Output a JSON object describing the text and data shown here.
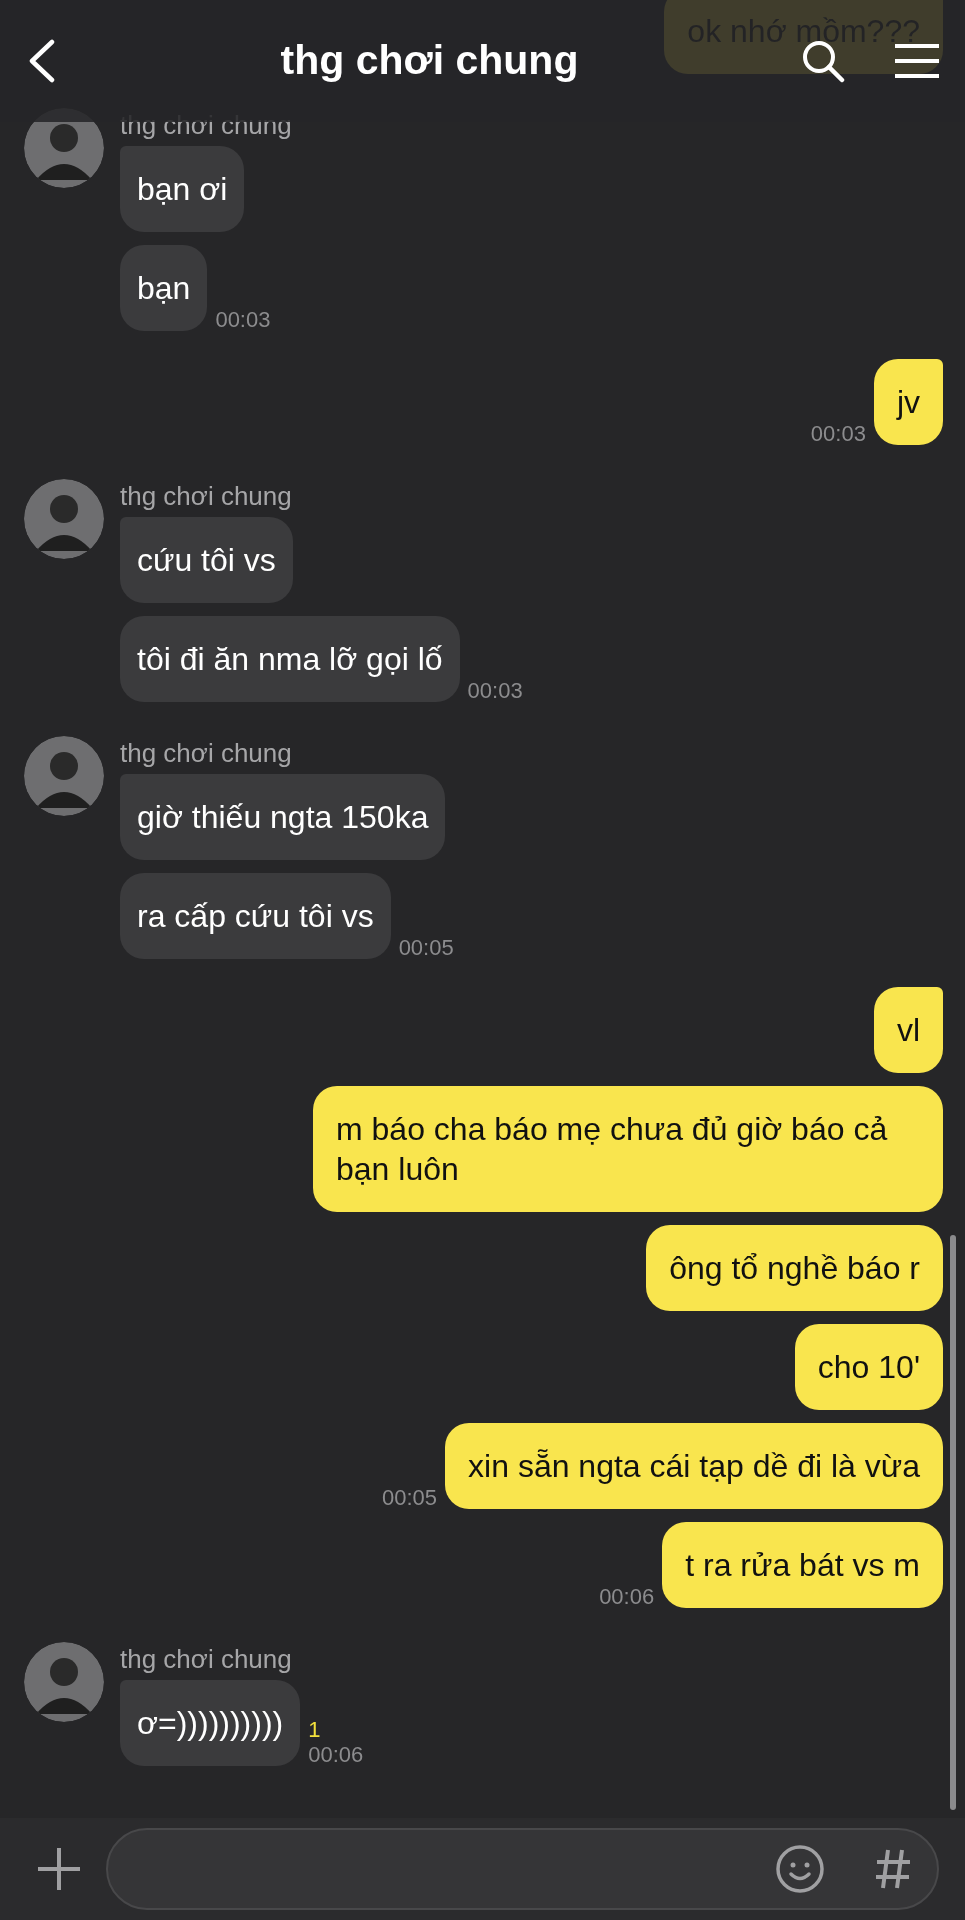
{
  "header": {
    "title": "thg chơi chung"
  },
  "messages": [
    {
      "kind": "outgoing",
      "bubbles": [
        {
          "text": "ok nhớ mồm???"
        }
      ]
    },
    {
      "kind": "incoming",
      "sender": "thg chơi chung",
      "bubbles": [
        {
          "text": "bạn ơi"
        },
        {
          "text": "bạn",
          "time": "00:03"
        }
      ]
    },
    {
      "kind": "outgoing",
      "bubbles": [
        {
          "text": "jv",
          "time": "00:03"
        }
      ]
    },
    {
      "kind": "incoming",
      "sender": "thg chơi chung",
      "bubbles": [
        {
          "text": "cứu tôi vs"
        },
        {
          "text": "tôi đi ăn nma lỡ gọi lố",
          "time": "00:03"
        }
      ]
    },
    {
      "kind": "incoming",
      "sender": "thg chơi chung",
      "bubbles": [
        {
          "text": "giờ thiếu ngta 150ka"
        },
        {
          "text": "ra cấp cứu tôi vs",
          "time": "00:05"
        }
      ]
    },
    {
      "kind": "outgoing",
      "bubbles": [
        {
          "text": "vl"
        },
        {
          "text": "m báo cha báo mẹ chưa đủ giờ báo cả bạn luôn"
        },
        {
          "text": "ông tổ nghề báo r"
        },
        {
          "text": "cho 10'"
        },
        {
          "text": "xin sẵn ngta cái tạp dề đi là vừa",
          "time": "00:05"
        },
        {
          "text": "t ra rửa bát vs m",
          "time": "00:06"
        }
      ]
    },
    {
      "kind": "incoming",
      "sender": "thg chơi chung",
      "bubbles": [
        {
          "text": "ơ=))))))))))",
          "unread": "1",
          "time": "00:06"
        }
      ]
    }
  ]
}
